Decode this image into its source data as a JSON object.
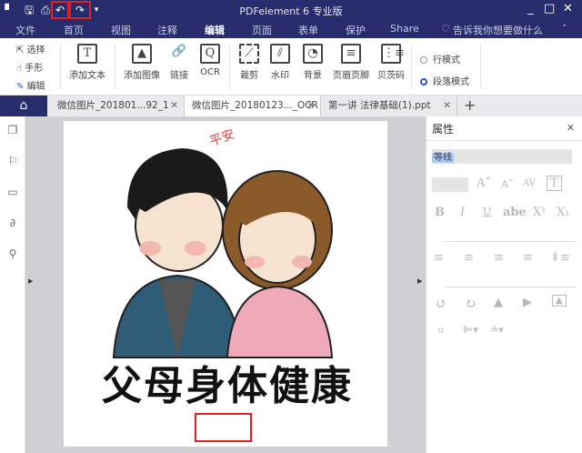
{
  "titlebar": {
    "title": "PDFelement  6 专业版",
    "minimize": "_",
    "maximize": "□",
    "close": "✕"
  },
  "menu": {
    "items": [
      "文件",
      "首页",
      "视图",
      "注释",
      "编辑",
      "页面",
      "表单",
      "保护",
      "Share"
    ],
    "active": "编辑",
    "tell_me": "告诉我你想要做什么"
  },
  "ribbon": {
    "select": "选择",
    "hand": "手形",
    "edit": "编辑",
    "add_text": "添加文本",
    "add_image": "添加图像",
    "link": "链接",
    "ocr": "OCR",
    "crop": "裁剪",
    "watermark": "水印",
    "background": "背景",
    "header_footer": "页眉页脚",
    "bates": "贝茨码",
    "line_mode": "行模式",
    "paragraph_mode": "段落模式"
  },
  "tabs": [
    {
      "label": "微信图片_201801...92_1"
    },
    {
      "label": "微信图片_20180123..._OCR"
    },
    {
      "label": "第一讲 法律基础(1).ppt"
    }
  ],
  "tab_close": "✕",
  "tab_add": "+",
  "document": {
    "stamp": "平安",
    "caption": "父母身体健康"
  },
  "properties": {
    "title": "属性",
    "close": "✕",
    "font": "等线",
    "bold": "B",
    "italic": "I",
    "underline": "U",
    "strike": "abe",
    "sup": "X¹",
    "sub": "X₁",
    "grow": "A˄",
    "shrink": "A˅",
    "spacing": "AV"
  },
  "colors": {
    "navy": "#272c6c",
    "accent": "#2f55d4",
    "highlight": "#e02020"
  }
}
